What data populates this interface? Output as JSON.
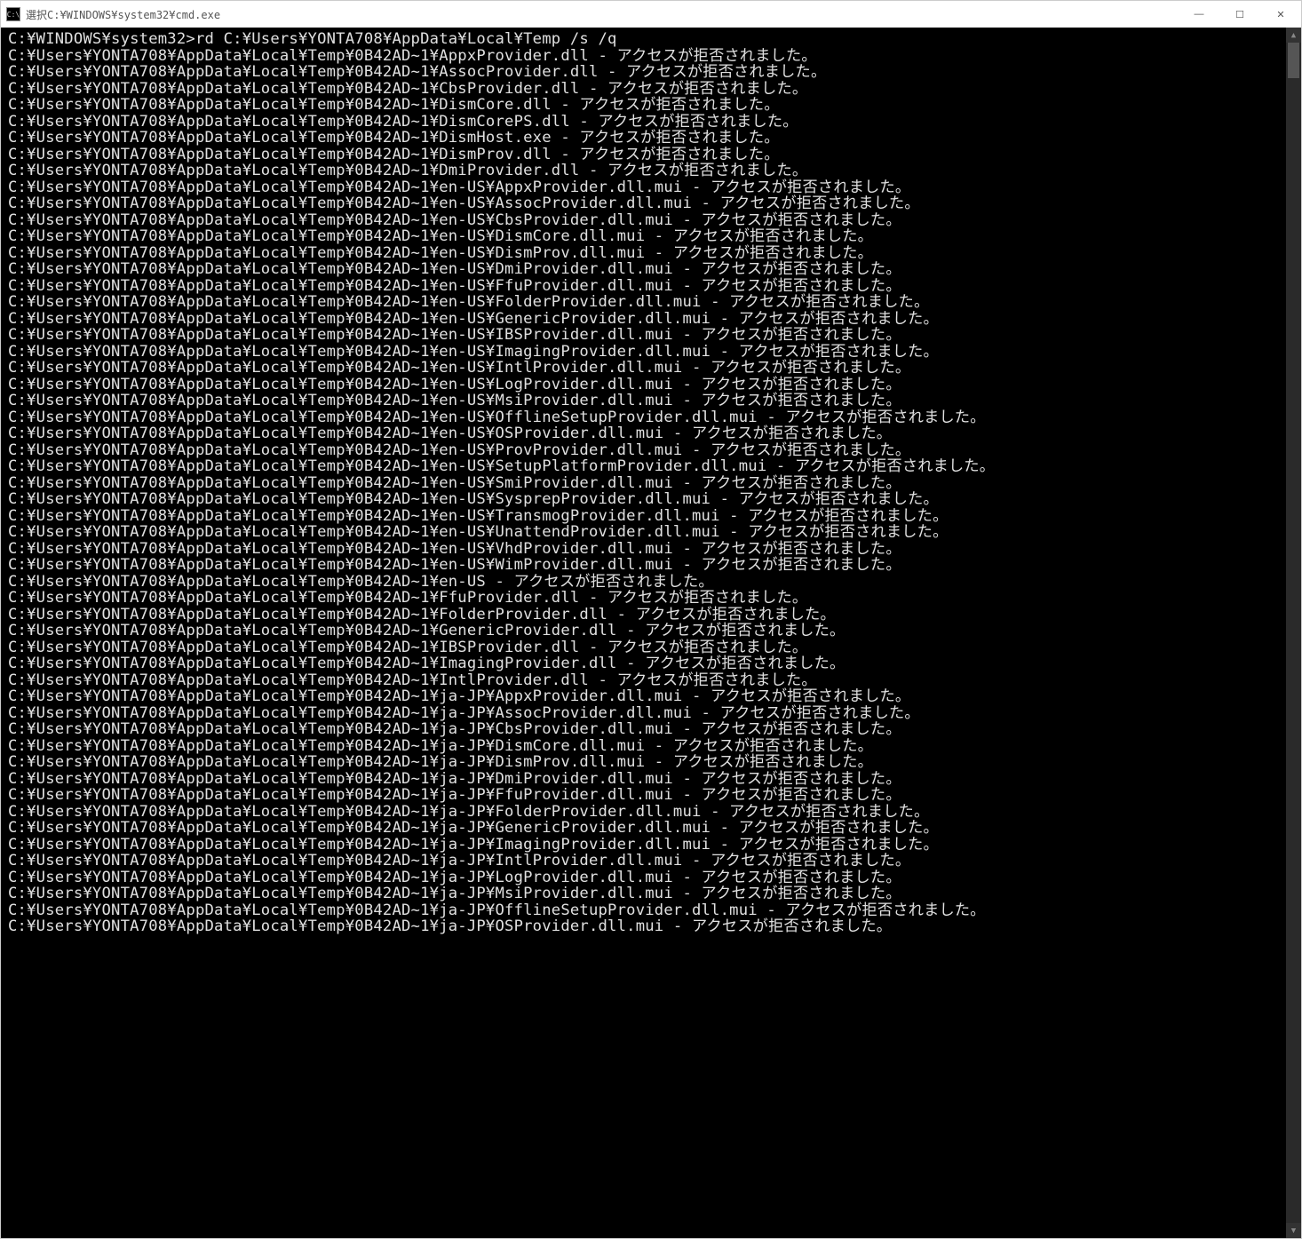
{
  "window": {
    "title": "選択C:¥WINDOWS¥system32¥cmd.exe",
    "icon_label": "C:\\"
  },
  "controls": {
    "minimize": "—",
    "maximize": "☐",
    "close": "✕"
  },
  "scrollbar": {
    "up": "▲",
    "down": "▼"
  },
  "prompt": "C:¥WINDOWS¥system32>",
  "command": "rd C:¥Users¥YONTA708¥AppData¥Local¥Temp /s /q",
  "base_path": "C:¥Users¥YONTA708¥AppData¥Local¥Temp¥0B42AD~1",
  "deny_msg": "アクセスが拒否されました。",
  "entries": [
    "¥AppxProvider.dll",
    "¥AssocProvider.dll",
    "¥CbsProvider.dll",
    "¥DismCore.dll",
    "¥DismCorePS.dll",
    "¥DismHost.exe",
    "¥DismProv.dll",
    "¥DmiProvider.dll",
    "¥en-US¥AppxProvider.dll.mui",
    "¥en-US¥AssocProvider.dll.mui",
    "¥en-US¥CbsProvider.dll.mui",
    "¥en-US¥DismCore.dll.mui",
    "¥en-US¥DismProv.dll.mui",
    "¥en-US¥DmiProvider.dll.mui",
    "¥en-US¥FfuProvider.dll.mui",
    "¥en-US¥FolderProvider.dll.mui",
    "¥en-US¥GenericProvider.dll.mui",
    "¥en-US¥IBSProvider.dll.mui",
    "¥en-US¥ImagingProvider.dll.mui",
    "¥en-US¥IntlProvider.dll.mui",
    "¥en-US¥LogProvider.dll.mui",
    "¥en-US¥MsiProvider.dll.mui",
    "¥en-US¥OfflineSetupProvider.dll.mui",
    "¥en-US¥OSProvider.dll.mui",
    "¥en-US¥ProvProvider.dll.mui",
    "¥en-US¥SetupPlatformProvider.dll.mui",
    "¥en-US¥SmiProvider.dll.mui",
    "¥en-US¥SysprepProvider.dll.mui",
    "¥en-US¥TransmogProvider.dll.mui",
    "¥en-US¥UnattendProvider.dll.mui",
    "¥en-US¥VhdProvider.dll.mui",
    "¥en-US¥WimProvider.dll.mui",
    "¥en-US",
    "¥FfuProvider.dll",
    "¥FolderProvider.dll",
    "¥GenericProvider.dll",
    "¥IBSProvider.dll",
    "¥ImagingProvider.dll",
    "¥IntlProvider.dll",
    "¥ja-JP¥AppxProvider.dll.mui",
    "¥ja-JP¥AssocProvider.dll.mui",
    "¥ja-JP¥CbsProvider.dll.mui",
    "¥ja-JP¥DismCore.dll.mui",
    "¥ja-JP¥DismProv.dll.mui",
    "¥ja-JP¥DmiProvider.dll.mui",
    "¥ja-JP¥FfuProvider.dll.mui",
    "¥ja-JP¥FolderProvider.dll.mui",
    "¥ja-JP¥GenericProvider.dll.mui",
    "¥ja-JP¥ImagingProvider.dll.mui",
    "¥ja-JP¥IntlProvider.dll.mui",
    "¥ja-JP¥LogProvider.dll.mui",
    "¥ja-JP¥MsiProvider.dll.mui",
    "¥ja-JP¥OfflineSetupProvider.dll.mui",
    "¥ja-JP¥OSProvider.dll.mui"
  ]
}
